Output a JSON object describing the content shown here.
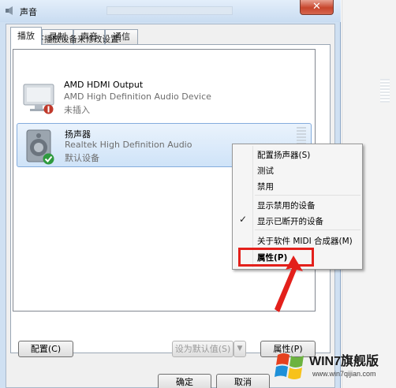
{
  "window": {
    "title": "声音",
    "close_glyph": "✕",
    "tabs": [
      {
        "label": "播放"
      },
      {
        "label": "录制"
      },
      {
        "label": "声音"
      },
      {
        "label": "通信"
      }
    ],
    "instruction": "选择以下播放设备来修改设置:"
  },
  "devices": [
    {
      "name": "AMD HDMI Output",
      "description": "AMD High Definition Audio Device",
      "status": "未插入",
      "icon": "monitor-icon",
      "badge": "disconnected-badge"
    },
    {
      "name": "扬声器",
      "description": "Realtek High Definition Audio",
      "status": "默认设备",
      "icon": "speaker-icon",
      "badge": "default-check-badge",
      "selected": true
    }
  ],
  "buttons": {
    "configure": "配置(C)",
    "set_default": "设为默认值(S)",
    "properties": "属性(P)",
    "ok": "确定",
    "cancel": "取消"
  },
  "context_menu": {
    "items": [
      {
        "label": "配置扬声器(S)"
      },
      {
        "label": "测试"
      },
      {
        "label": "禁用"
      },
      {
        "label": "显示禁用的设备",
        "checked": false
      },
      {
        "label": "显示已断开的设备",
        "checked": true
      },
      {
        "label": "关于软件 MIDI 合成器(M)"
      },
      {
        "label": "属性(P)",
        "highlighted": true
      }
    ],
    "check_glyph": "✓"
  },
  "watermark": {
    "text": "WIN7旗舰版",
    "url": "www.win7qijian.com",
    "logo": "windows-logo-icon"
  },
  "colors": {
    "highlight_box": "#e3201b",
    "selection": "#cfe3f8",
    "close_button": "#c7452c"
  }
}
